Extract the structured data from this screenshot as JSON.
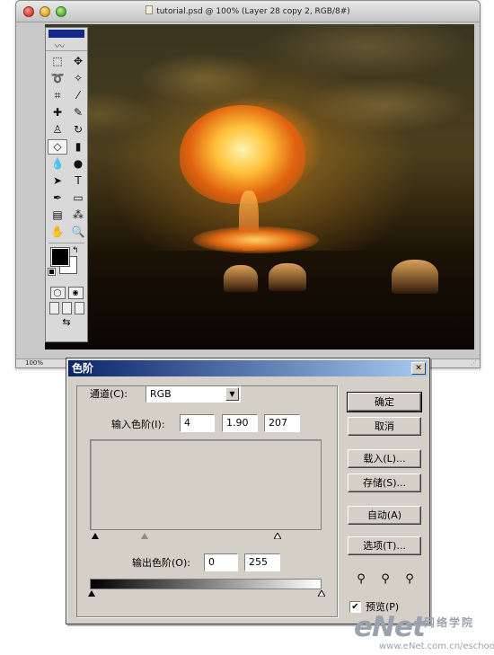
{
  "document_window": {
    "title": "tutorial.psd @ 100% (Layer 28 copy 2, RGB/8#)",
    "zoom": "100%"
  },
  "toolbox": {
    "tools": [
      {
        "name": "marquee-tool",
        "glyph": "⬚"
      },
      {
        "name": "move-tool",
        "glyph": "✥"
      },
      {
        "name": "lasso-tool",
        "glyph": "➰"
      },
      {
        "name": "magic-wand-tool",
        "glyph": "✧"
      },
      {
        "name": "crop-tool",
        "glyph": "⌗"
      },
      {
        "name": "slice-tool",
        "glyph": "⁄"
      },
      {
        "name": "healing-brush-tool",
        "glyph": "✚"
      },
      {
        "name": "brush-tool",
        "glyph": "✎"
      },
      {
        "name": "clone-stamp-tool",
        "glyph": "♙"
      },
      {
        "name": "history-brush-tool",
        "glyph": "↻"
      },
      {
        "name": "eraser-tool",
        "glyph": "◇"
      },
      {
        "name": "gradient-tool",
        "glyph": "▮"
      },
      {
        "name": "blur-tool",
        "glyph": "💧"
      },
      {
        "name": "dodge-tool",
        "glyph": "●"
      },
      {
        "name": "path-selection-tool",
        "glyph": "➤"
      },
      {
        "name": "type-tool",
        "glyph": "T"
      },
      {
        "name": "pen-tool",
        "glyph": "✒"
      },
      {
        "name": "shape-tool",
        "glyph": "▭"
      },
      {
        "name": "notes-tool",
        "glyph": "▤"
      },
      {
        "name": "eyedropper-tool",
        "glyph": "⁂"
      },
      {
        "name": "hand-tool",
        "glyph": "✋"
      },
      {
        "name": "zoom-tool",
        "glyph": "🔍"
      }
    ]
  },
  "levels_dialog": {
    "title": "色阶",
    "channel_label": "通道(C):",
    "channel_value": "RGB",
    "input_label": "输入色阶(I):",
    "input_black": "4",
    "input_gamma": "1.90",
    "input_white": "207",
    "output_label": "输出色阶(O):",
    "output_black": "0",
    "output_white": "255",
    "buttons": {
      "ok": "确定",
      "cancel": "取消",
      "load": "载入(L)...",
      "save": "存储(S)...",
      "auto": "自动(A)",
      "options": "选项(T)..."
    },
    "preview_label": "预览(P)",
    "preview_checked": true
  },
  "watermark": {
    "logo": "eNet",
    "tagline": "网络学院",
    "url": "www.eNet.com.cn/eschool"
  }
}
